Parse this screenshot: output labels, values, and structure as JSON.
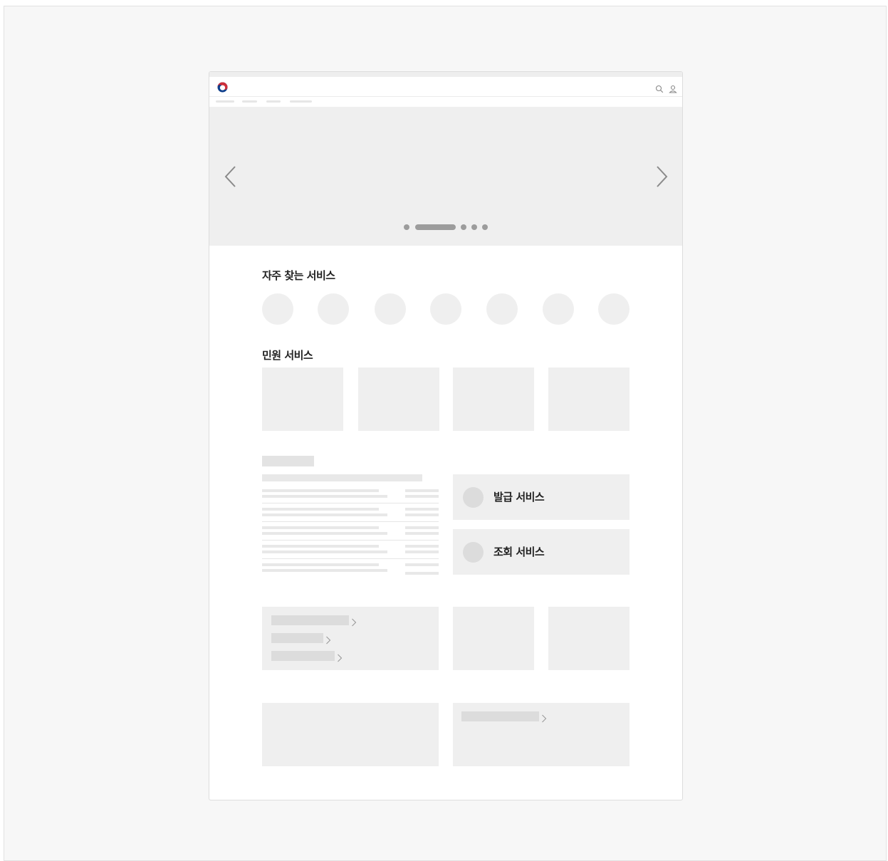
{
  "sections": {
    "frequent_services_title": "자주 찾는 서비스",
    "civil_services_title": "민원 서비스"
  },
  "services": {
    "issuance_label": "발급 서비스",
    "inquiry_label": "조회 서비스"
  },
  "icons": {
    "logo": "korea-government-emblem-icon",
    "search": "search-icon",
    "user": "user-icon",
    "prev": "chevron-left-icon",
    "next": "chevron-right-icon",
    "link_arrow": "chevron-right-icon"
  },
  "carousel": {
    "slide_count": 5,
    "active_slide": 2
  },
  "colors": {
    "emblem_red": "#cd2e3a",
    "emblem_blue": "#0f3f8c",
    "placeholder": "#efefef",
    "text": "#222222"
  }
}
